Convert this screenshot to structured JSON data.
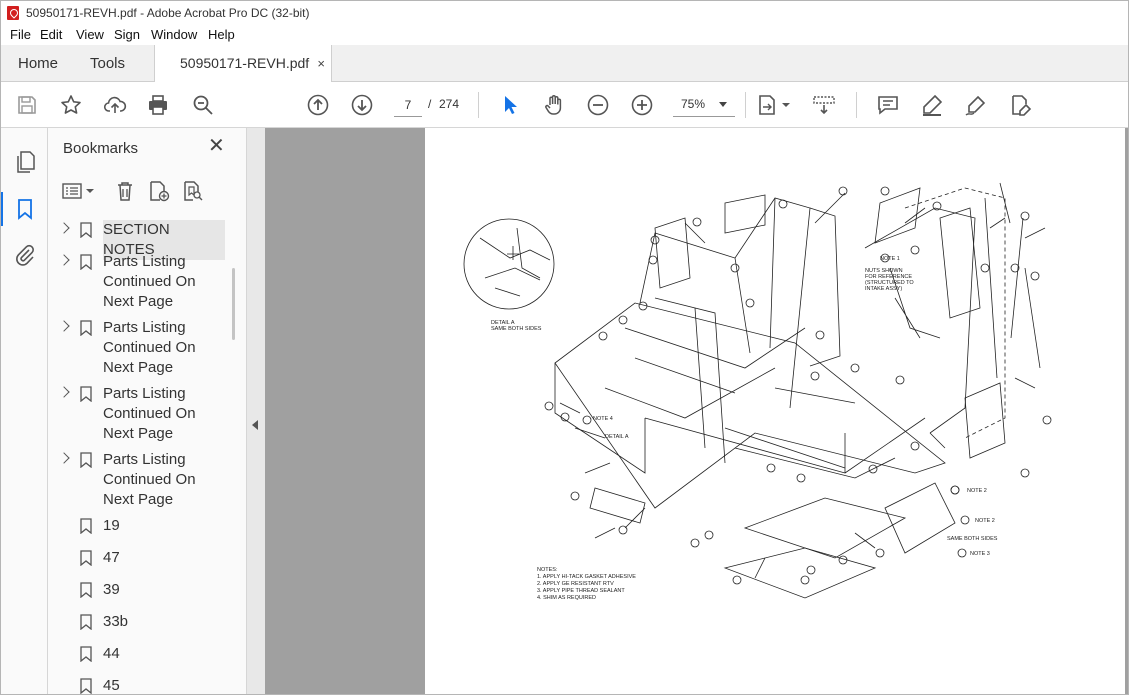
{
  "window": {
    "title": "50950171-REVH.pdf - Adobe Acrobat Pro DC (32-bit)"
  },
  "menu": [
    "File",
    "Edit",
    "View",
    "Sign",
    "Window",
    "Help"
  ],
  "tabs": {
    "home": "Home",
    "tools": "Tools",
    "document": "50950171-REVH.pdf",
    "close": "×"
  },
  "toolbar": {
    "current_page": "7",
    "separator": "/",
    "total_pages": "274",
    "zoom": "75%"
  },
  "bookmarks": {
    "title": "Bookmarks",
    "close": "✕",
    "items": [
      {
        "label": "SECTION NOTES",
        "expandable": true
      },
      {
        "label": "Parts Listing Continued On Next Page",
        "expandable": true
      },
      {
        "label": "Parts Listing Continued On Next Page",
        "expandable": true
      },
      {
        "label": "Parts Listing Continued On Next Page",
        "expandable": true
      },
      {
        "label": "Parts Listing Continued On Next Page",
        "expandable": true
      },
      {
        "label": "19",
        "expandable": false
      },
      {
        "label": "47",
        "expandable": false
      },
      {
        "label": "39",
        "expandable": false
      },
      {
        "label": "33b",
        "expandable": false
      },
      {
        "label": "44",
        "expandable": false
      },
      {
        "label": "45",
        "expandable": false
      }
    ]
  },
  "drawing": {
    "detail_caption_1": "DETAIL A",
    "detail_caption_2": "SAME BOTH SIDES",
    "detail_ref": "DETAIL A",
    "note_ref_4": "NOTE 4",
    "note_ref_1": "NOTE 1",
    "note_ref_2a": "NOTE 2",
    "note_ref_2b": "NOTE 2",
    "note_ref_3": "NOTE 3",
    "same_both_sides": "SAME BOTH SIDES",
    "nuts_note_1": "NUTS SHOWN",
    "nuts_note_2": "FOR REFERENCE",
    "nuts_note_3": "(STRUCTURED TO",
    "nuts_note_4": "INTAKE ASSY)",
    "notes_title": "NOTES:",
    "notes": [
      "1. APPLY HI-TACK GASKET ADHESIVE",
      "2. APPLY GE RESISTANT RTV",
      "3. APPLY PIPE THREAD SEALANT",
      "4. SHIM AS REQUIRED"
    ]
  },
  "icons": {
    "save": "save-icon",
    "star": "star-icon",
    "upload": "upload-icon",
    "print": "print-icon",
    "zoom_search": "zoom-search-icon",
    "prev_page": "prev-page-icon",
    "next_page": "next-page-icon",
    "select": "select-arrow-icon",
    "hand": "hand-icon",
    "zoom_out": "zoom-out-icon",
    "zoom_in": "zoom-in-icon"
  }
}
